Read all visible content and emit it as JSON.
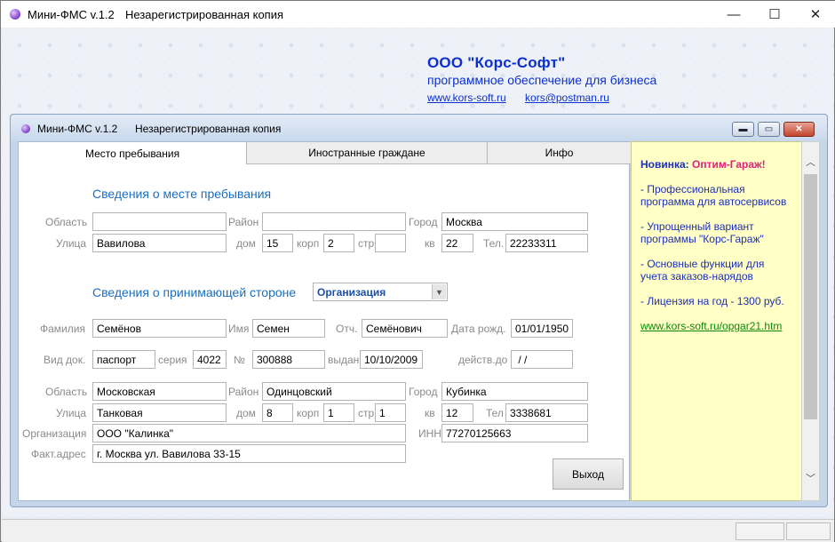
{
  "window": {
    "app_title": "Мини-ФМС v.1.2",
    "subtitle": "Незарегистрированная копия",
    "minimize": "—",
    "maximize": "☐",
    "close": "✕"
  },
  "company": {
    "name": "ООО \"Корс-Софт\"",
    "tagline": "программное обеспечение для бизнеса",
    "site": "www.kors-soft.ru",
    "email": "kors@postman.ru"
  },
  "inner": {
    "app_title": "Мини-ФМС v.1.2",
    "subtitle": "Незарегистрированная копия",
    "minimize": "▬",
    "maximize": "▭",
    "close": "✕"
  },
  "tabs": [
    {
      "label": "Место пребывания"
    },
    {
      "label": "Иностранные граждане"
    },
    {
      "label": "Инфо"
    }
  ],
  "stay": {
    "section_title": "Сведения о месте пребывания",
    "labels": {
      "region": "Область",
      "district": "Район",
      "city": "Город",
      "street": "Улица",
      "house": "дом",
      "building": "корп",
      "structure": "стр",
      "apt": "кв",
      "phone": "Тел."
    },
    "values": {
      "region": "",
      "district": "",
      "city": "Москва",
      "street": "Вавилова",
      "house": "15",
      "building": "2",
      "structure": "",
      "apt": "22",
      "phone": "22233311"
    }
  },
  "host": {
    "section_title": "Сведения о принимающей стороне",
    "type_selected": "Организация",
    "labels": {
      "surname": "Фамилия",
      "name": "Имя",
      "patronymic": "Отч.",
      "birth": "Дата рожд.",
      "doc_type": "Вид док.",
      "series": "серия",
      "number": "№",
      "issued": "выдан",
      "valid": "действ.до",
      "region": "Область",
      "district": "Район",
      "city": "Город",
      "street": "Улица",
      "house": "дом",
      "building": "корп",
      "structure": "стр",
      "apt": "кв",
      "phone": "Тел",
      "org": "Организация",
      "inn": "ИНН",
      "fact_address": "Факт.адрес"
    },
    "values": {
      "surname": "Семёнов",
      "name": "Семен",
      "patronymic": "Семёнович",
      "birth": "01/01/1950",
      "doc_type": "паспорт",
      "series": "4022",
      "number": "300888",
      "issued": "10/10/2009",
      "valid": " / /",
      "region": "Московская",
      "district": "Одинцовский",
      "city": "Кубинка",
      "street": "Танковая",
      "house": "8",
      "building": "1",
      "structure": "1",
      "apt": "12",
      "phone": "3338681",
      "org": "ООО \"Калинка\"",
      "inn": "77270125663",
      "fact_address": "г. Москва ул. Вавилова 33-15"
    }
  },
  "exit_label": "Выход",
  "ad": {
    "new_prefix": "Новинка: ",
    "product": "Оптим-Гараж",
    "excl": "!",
    "line1": "- Профессиональная программа для автосервисов",
    "line2": "- Упрощенный вариант программы \"Корс-Гараж\"",
    "line3": "- Основные функции для учета заказов-нарядов",
    "line4": "- Лицензия на год - 1300 руб.",
    "link": "www.kors-soft.ru/opgar21.htm"
  },
  "scroll": {
    "up": "︿",
    "down": "﹀"
  }
}
